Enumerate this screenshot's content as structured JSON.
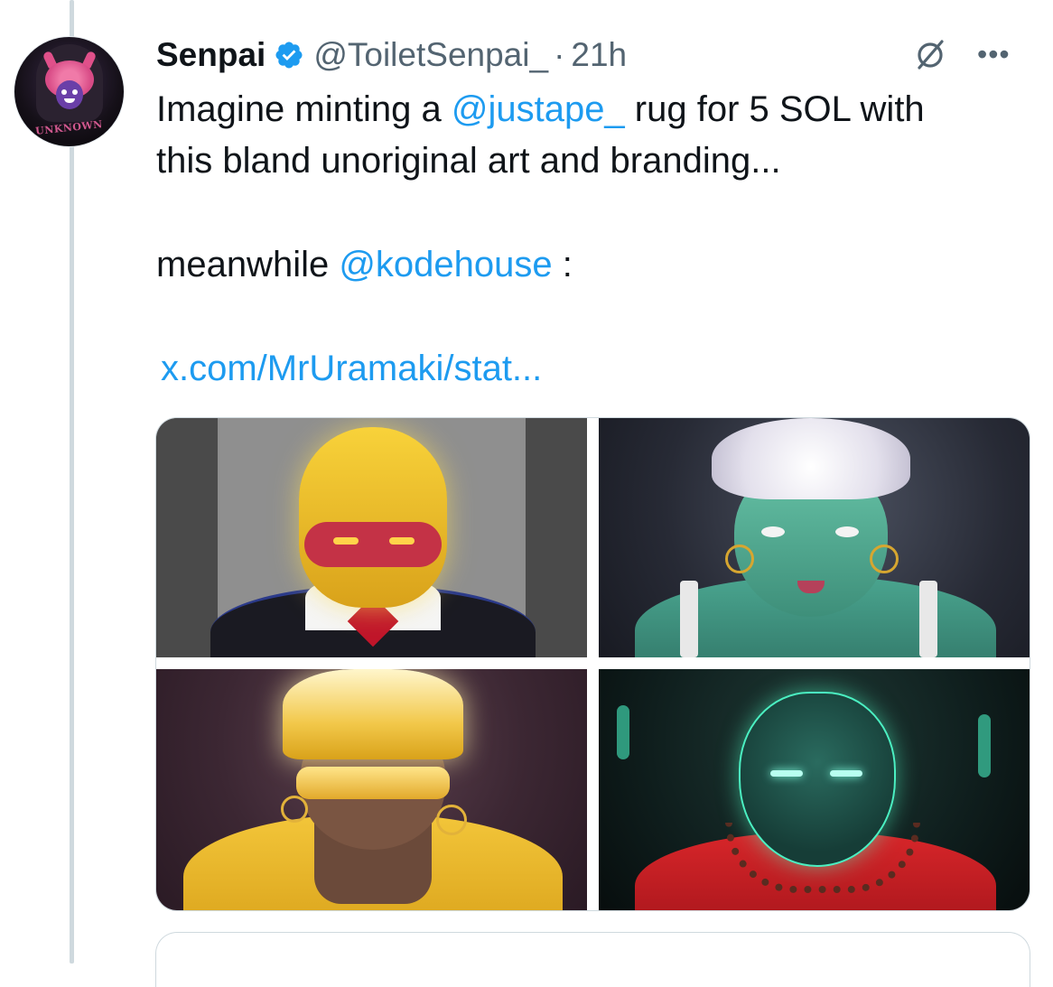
{
  "tweet": {
    "author": {
      "name": "Senpai",
      "handle": "@ToiletSenpai_",
      "verified": true,
      "avatar_text": "UNKNOWN"
    },
    "separator": "·",
    "time": "21h",
    "text": {
      "line1_prefix": "Imagine minting a ",
      "line1_mention": "@justape_",
      "line1_suffix": " rug for 5 SOL with",
      "line2": "this bland unoriginal art and branding...",
      "line3_prefix": "meanwhile ",
      "line3_mention": "@kodehouse",
      "line3_suffix": " :",
      "link": "x.com/MrUramaki/stat..."
    },
    "media": {
      "layout": "2x2 grid",
      "images": [
        "yellow-masked-character",
        "green-zombie-character",
        "gold-visor-character",
        "glowing-green-character"
      ]
    }
  },
  "icons": {
    "verified": "verified-badge-icon",
    "grok": "grok-icon",
    "more": "more-icon"
  },
  "colors": {
    "accent": "#1d9bf0",
    "text": "#0f1419",
    "secondary": "#536471",
    "border": "#cfd9de"
  }
}
